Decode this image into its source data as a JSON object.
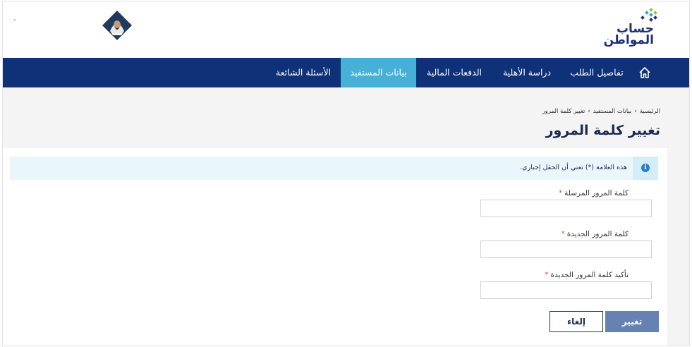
{
  "header": {
    "logo_line1": "حساب",
    "logo_line2": "المواطن",
    "chevron": "ˇ"
  },
  "nav": {
    "items": [
      {
        "label": "تفاصيل الطلب"
      },
      {
        "label": "دراسة الأهلية"
      },
      {
        "label": "الدفعات المالية"
      },
      {
        "label": "بيانات المستفيد",
        "active": true
      },
      {
        "label": "الأسئلة الشائعة"
      }
    ],
    "home_icon": "home-icon"
  },
  "breadcrumb": {
    "home": "الرئيسية",
    "parent": "بيانات المستفيد",
    "current": "تغيير كلمة المرور",
    "separator": "›"
  },
  "page": {
    "title": "تغيير كلمة المرور"
  },
  "info": {
    "icon": "i",
    "text": "هذه العلامة (*) تعني أن الحقل إجباري."
  },
  "form": {
    "required_mark": "*",
    "fields": [
      {
        "label": "كلمة المرور المرسلة",
        "value": ""
      },
      {
        "label": "كلمة المرور الجديدة",
        "value": ""
      },
      {
        "label": "تأكيد كلمة المرور الجديدة",
        "value": ""
      }
    ],
    "submit_label": "تغيير",
    "cancel_label": "إلغاء"
  },
  "colors": {
    "nav_bg": "#0e3178",
    "nav_active": "#46b0d7",
    "submit_bg": "#6582b2",
    "info_bg": "#e9f7fd"
  }
}
